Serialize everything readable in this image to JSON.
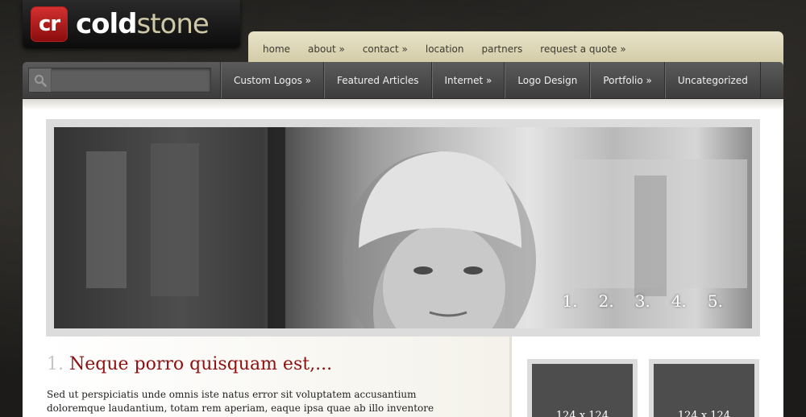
{
  "logo": {
    "mark": "cr",
    "bold": "cold",
    "light": "stone"
  },
  "top_nav": [
    "home",
    "about »",
    "contact »",
    "location",
    "partners",
    "request a quote »"
  ],
  "search": {
    "placeholder": ""
  },
  "categories": [
    "Custom Logos »",
    "Featured Articles",
    "Internet »",
    "Logo Design",
    "Portfolio »",
    "Uncategorized"
  ],
  "slider": {
    "numbers": [
      "1.",
      "2.",
      "3.",
      "4.",
      "5."
    ]
  },
  "post": {
    "number": "1.",
    "title": "Neque porro quisquam est,...",
    "excerpt": "Sed ut perspiciatis unde omnis iste natus error sit voluptatem accusantium doloremque laudantium, totam rem aperiam, eaque ipsa quae ab illo inventore"
  },
  "ads": [
    "124 x 124",
    "124 x 124"
  ]
}
